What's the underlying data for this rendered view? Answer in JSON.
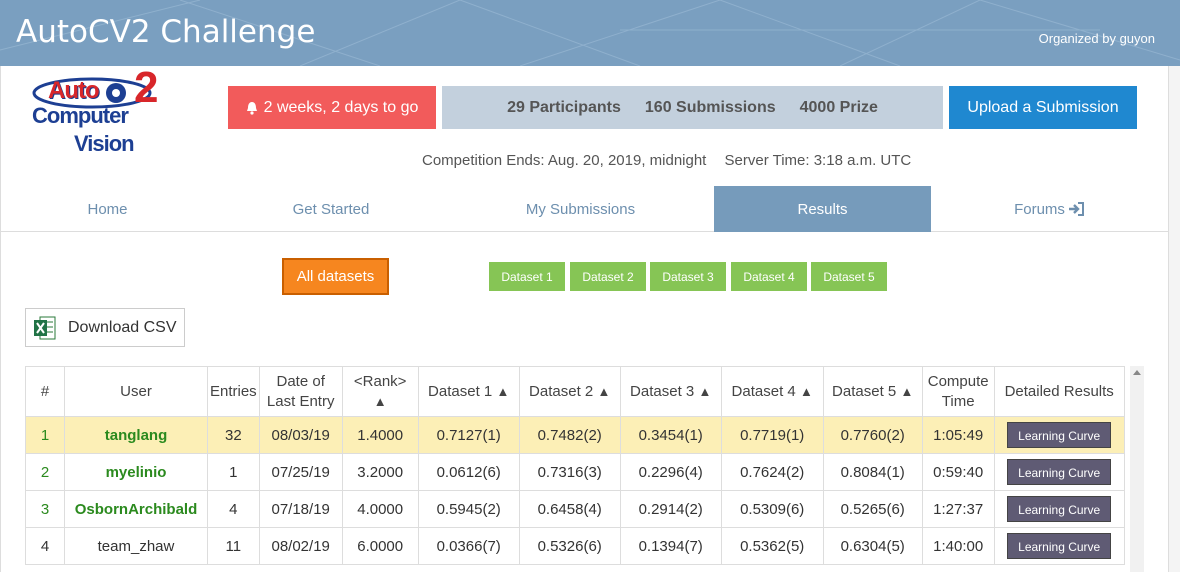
{
  "header": {
    "title": "AutoCV2 Challenge",
    "organizer": "Organized by guyon"
  },
  "logo": {
    "auto": "Auto",
    "two": "2",
    "computer": "Computer",
    "vision": "Vision"
  },
  "deadline": {
    "icon": "bell-icon",
    "text": "2 weeks, 2 days to go"
  },
  "stats": {
    "participants": "29 Participants",
    "submissions": "160 Submissions",
    "prize": "4000 Prize"
  },
  "upload_label": "Upload a Submission",
  "timing": {
    "competition_ends": "Competition Ends: Aug. 20, 2019, midnight",
    "server_time": "Server Time: 3:18 a.m. UTC"
  },
  "nav": {
    "home": "Home",
    "get_started": "Get Started",
    "my_submissions": "My Submissions",
    "results": "Results",
    "forums": "Forums",
    "active": "Results"
  },
  "filters": {
    "all": "All datasets",
    "datasets": [
      "Dataset 1",
      "Dataset 2",
      "Dataset 3",
      "Dataset 4",
      "Dataset 5"
    ]
  },
  "download_csv": "Download CSV",
  "table": {
    "headers": {
      "num": "#",
      "user": "User",
      "entries": "Entries",
      "date_l1": "Date of",
      "date_l2": "Last Entry",
      "rank": "<Rank>",
      "d1": "Dataset 1",
      "d2": "Dataset 2",
      "d3": "Dataset 3",
      "d4": "Dataset 4",
      "d5": "Dataset 5",
      "compute_l1": "Compute",
      "compute_l2": "Time",
      "detailed": "Detailed Results"
    },
    "rows": [
      {
        "num": "1",
        "user": "tanglang",
        "entries": "32",
        "date": "08/03/19",
        "rank": "1.4000",
        "d1": "0.7127(1)",
        "d2": "0.7482(2)",
        "d3": "0.3454(1)",
        "d4": "0.7719(1)",
        "d5": "0.7760(2)",
        "time": "1:05:49",
        "action": "Learning Curve"
      },
      {
        "num": "2",
        "user": "myelinio",
        "entries": "1",
        "date": "07/25/19",
        "rank": "3.2000",
        "d1": "0.0612(6)",
        "d2": "0.7316(3)",
        "d3": "0.2296(4)",
        "d4": "0.7624(2)",
        "d5": "0.8084(1)",
        "time": "0:59:40",
        "action": "Learning Curve"
      },
      {
        "num": "3",
        "user": "OsbornArchibald",
        "entries": "4",
        "date": "07/18/19",
        "rank": "4.0000",
        "d1": "0.5945(2)",
        "d2": "0.6458(4)",
        "d3": "0.2914(2)",
        "d4": "0.5309(6)",
        "d5": "0.5265(6)",
        "time": "1:27:37",
        "action": "Learning Curve"
      },
      {
        "num": "4",
        "user": "team_zhaw",
        "entries": "11",
        "date": "08/02/19",
        "rank": "6.0000",
        "d1": "0.0366(7)",
        "d2": "0.5326(6)",
        "d3": "0.1394(7)",
        "d4": "0.5362(5)",
        "d5": "0.6304(5)",
        "time": "1:40:00",
        "action": "Learning Curve"
      }
    ]
  },
  "colors": {
    "header_bg": "#7a9fc0",
    "deadline_bg": "#f25b5b",
    "stats_bg": "#c3d0dd",
    "upload_bg": "#1f88d0",
    "active_tab": "#769bbb",
    "all_datasets_bg": "#f6861f",
    "dataset_btn_bg": "#86c555",
    "first_row_bg": "#fcefb6",
    "learning_curve_bg": "#5f5b74"
  }
}
